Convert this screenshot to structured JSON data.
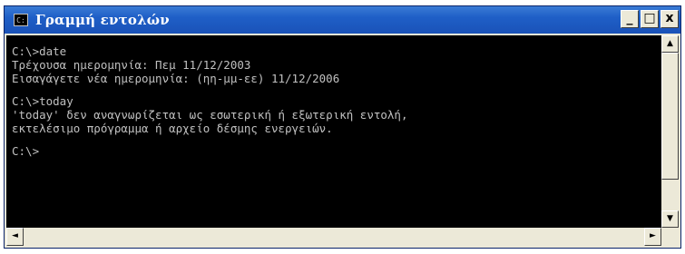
{
  "window": {
    "title": "Γραμμή εντολών",
    "icon": "console-icon",
    "controls": {
      "minimize_label": "_",
      "maximize_label": "□",
      "close_label": "x"
    }
  },
  "console": {
    "lines": [
      "C:\\>date",
      "Τρέχουσα ημερομηνία: Πεμ 11/12/2003",
      "Εισαγάγετε νέα ημερομηνία: (ηη-μμ-εε) 11/12/2006",
      "",
      "C:\\>today",
      "'today' δεν αναγνωρίζεται ως εσωτερική ή εξωτερική εντολή,",
      "εκτελέσιμο πρόγραμμα ή αρχείο δέσμης ενεργειών.",
      "",
      "C:\\>"
    ]
  },
  "scrollbars": {
    "up_arrow": "▲",
    "down_arrow": "▼",
    "left_arrow": "◄",
    "right_arrow": "►"
  },
  "colors": {
    "titlebar": "#1f5fc7",
    "console_bg": "#000000",
    "console_text": "#c0c0c0",
    "chrome": "#ece9d8"
  }
}
